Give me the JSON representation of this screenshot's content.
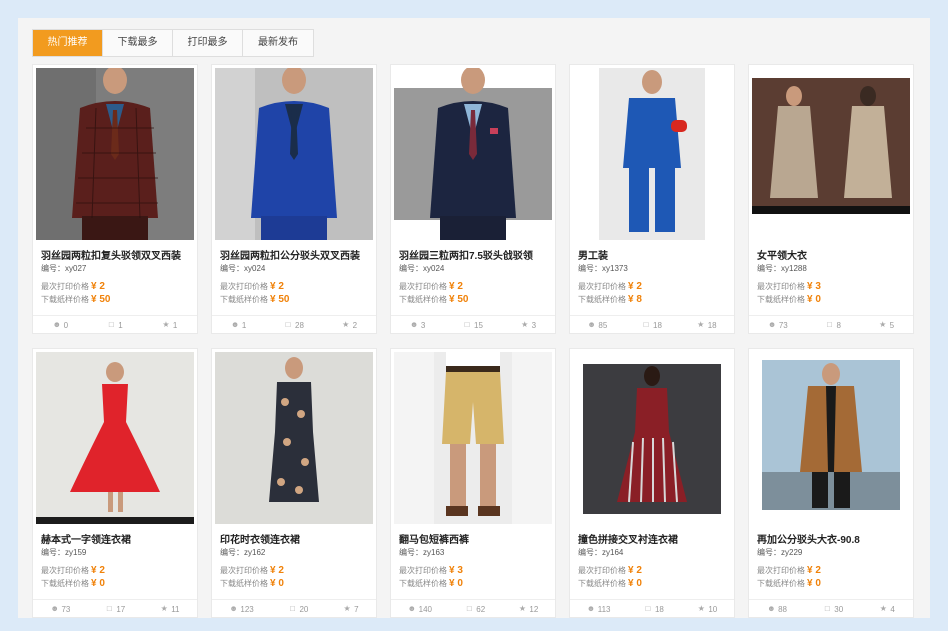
{
  "tabs": [
    {
      "label": "热门推荐",
      "active": true
    },
    {
      "label": "下载最多",
      "active": false
    },
    {
      "label": "打印最多",
      "active": false
    },
    {
      "label": "最新发布",
      "active": false
    }
  ],
  "price_labels": {
    "line1": "最次打印价格",
    "line2": "下载纸样价格"
  },
  "icons": {
    "views": "user-icon",
    "comments": "comment-icon",
    "likes": "star-icon"
  },
  "cards": [
    {
      "title": "羽丝园两粒扣复头驳领双叉西装",
      "code": "编号：xy027",
      "price1": "¥ 2",
      "price2": "¥ 50",
      "views": "0",
      "comments": "1",
      "likes": "1",
      "theme": "plaid-suit"
    },
    {
      "title": "羽丝园两粒扣公分驳头双叉西装",
      "code": "编号：xy024",
      "price1": "¥ 2",
      "price2": "¥ 50",
      "views": "1",
      "comments": "28",
      "likes": "2",
      "theme": "blue-suit"
    },
    {
      "title": "羽丝园三粒两扣7.5驳头戗驳领",
      "code": "编号：xy024",
      "price1": "¥ 2",
      "price2": "¥ 50",
      "views": "3",
      "comments": "15",
      "likes": "3",
      "theme": "navy-suit"
    },
    {
      "title": "男工装",
      "code": "编号：xy1373",
      "price1": "¥ 2",
      "price2": "¥ 8",
      "views": "85",
      "comments": "18",
      "likes": "18",
      "theme": "workwear"
    },
    {
      "title": "女平领大衣",
      "code": "编号：xy1288",
      "price1": "¥ 3",
      "price2": "¥ 0",
      "views": "73",
      "comments": "8",
      "likes": "5",
      "theme": "beige-coat"
    },
    {
      "title": "赫本式一字领连衣裙",
      "code": "编号：zy159",
      "price1": "¥ 2",
      "price2": "¥ 0",
      "views": "73",
      "comments": "17",
      "likes": "11",
      "theme": "red-dress"
    },
    {
      "title": "印花时衣领连衣裙",
      "code": "编号：zy162",
      "price1": "¥ 2",
      "price2": "¥ 0",
      "views": "123",
      "comments": "20",
      "likes": "7",
      "theme": "print-dress"
    },
    {
      "title": "翻马包短裤西裤",
      "code": "编号：zy163",
      "price1": "¥ 3",
      "price2": "¥ 0",
      "views": "140",
      "comments": "62",
      "likes": "12",
      "theme": "shorts"
    },
    {
      "title": "撞色拼接交叉衬连衣裙",
      "code": "编号：zy164",
      "price1": "¥ 2",
      "price2": "¥ 0",
      "views": "113",
      "comments": "18",
      "likes": "10",
      "theme": "stripe-dress"
    },
    {
      "title": "再加公分驳头大衣-90.8",
      "code": "编号：zy229",
      "price1": "¥ 2",
      "price2": "¥ 0",
      "views": "88",
      "comments": "30",
      "likes": "4",
      "theme": "camel-coat"
    }
  ]
}
